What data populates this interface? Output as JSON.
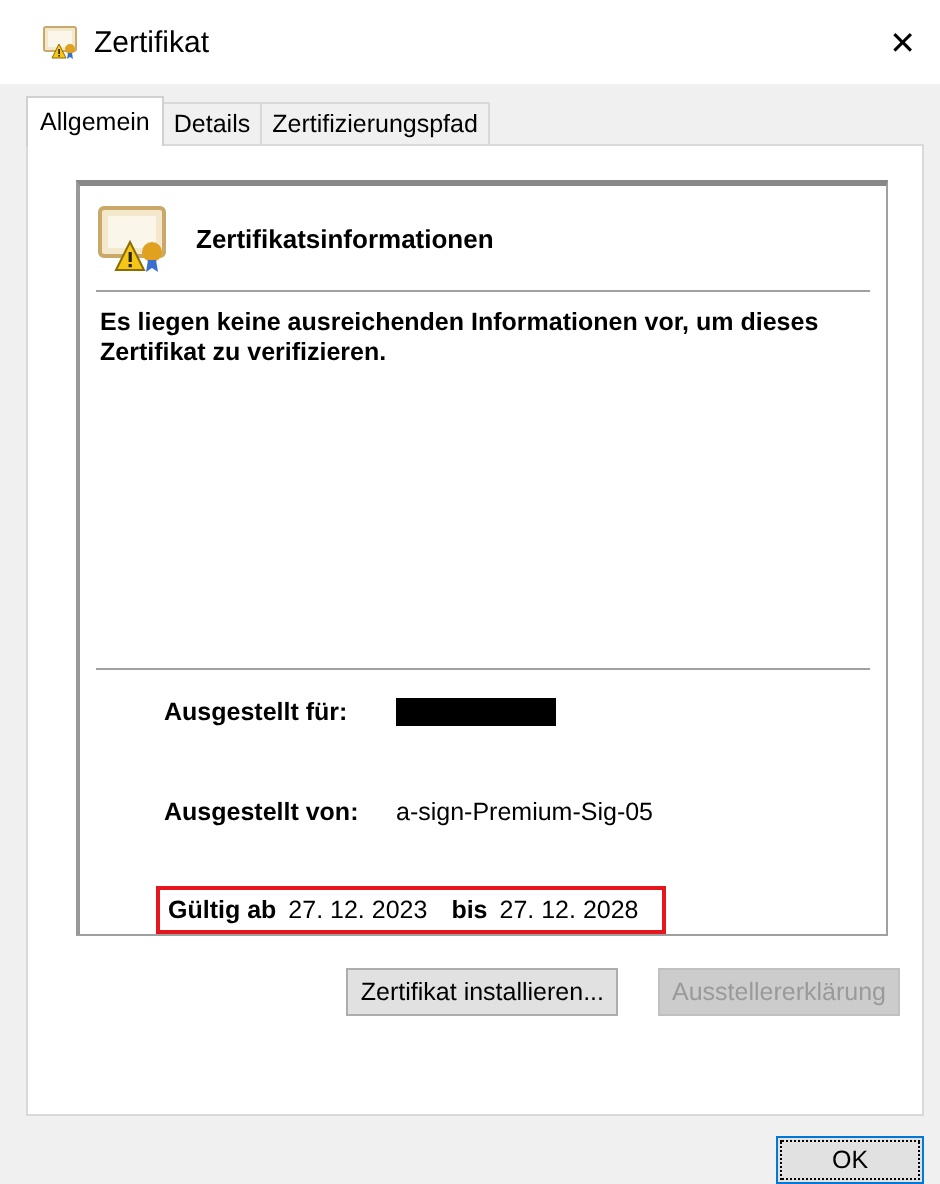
{
  "window": {
    "title": "Zertifikat",
    "close": "✕"
  },
  "tabs": [
    {
      "label": "Allgemein",
      "selected": true
    },
    {
      "label": "Details",
      "selected": false
    },
    {
      "label": "Zertifizierungspfad",
      "selected": false
    }
  ],
  "info": {
    "heading": "Zertifikatsinformationen",
    "message": "Es liegen keine ausreichenden Informationen vor, um dieses Zertifikat zu verifizieren.",
    "issued_to": {
      "label": "Ausgestellt für:",
      "redacted": true
    },
    "issued_by": {
      "label": "Ausgestellt von:",
      "value": "a-sign-Premium-Sig-05"
    },
    "validity": {
      "from_label": "Gültig ab",
      "from": "27. 12. 2023",
      "to_label": "bis",
      "to": "27. 12. 2028",
      "highlighted": true
    }
  },
  "buttons": [
    {
      "label": "Zertifikat installieren...",
      "disabled": false
    },
    {
      "label": "Ausstellererklärung",
      "disabled": true
    }
  ],
  "ok_button": {
    "label": "OK",
    "focused": true
  }
}
